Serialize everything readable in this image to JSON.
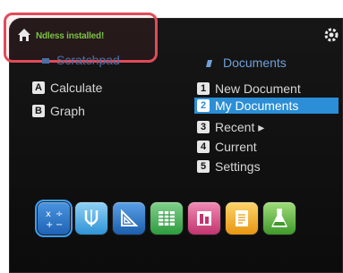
{
  "status_bar": {
    "home_icon": "home-icon",
    "text": "Ndless installed!",
    "settings_icon": "settings-icon"
  },
  "scratchpad": {
    "title": "Scratchpad",
    "items": [
      {
        "key": "A",
        "label": "Calculate"
      },
      {
        "key": "B",
        "label": "Graph"
      }
    ]
  },
  "documents": {
    "title": "Documents",
    "items": [
      {
        "key": "1",
        "label": "New Document",
        "selected": false
      },
      {
        "key": "2",
        "label": "My Documents",
        "selected": true
      },
      {
        "key": "3",
        "label": "Recent ▸",
        "selected": false
      },
      {
        "key": "4",
        "label": "Current",
        "selected": false
      },
      {
        "key": "5",
        "label": "Settings",
        "selected": false
      }
    ]
  },
  "app_bar": [
    {
      "name": "calculator-app-icon",
      "color": "#2f7fd4",
      "active": true
    },
    {
      "name": "graphs-app-icon",
      "color": "#39a7e6",
      "active": false
    },
    {
      "name": "geometry-app-icon",
      "color": "#2f7fd4",
      "active": false
    },
    {
      "name": "lists-spreadsheet-app-icon",
      "color": "#38b04a",
      "active": false
    },
    {
      "name": "data-statistics-app-icon",
      "color": "#d94a86",
      "active": false
    },
    {
      "name": "notes-app-icon",
      "color": "#f2a51c",
      "active": false
    },
    {
      "name": "vernier-dataquest-app-icon",
      "color": "#5cb33c",
      "active": false
    }
  ],
  "colors": {
    "status_text": "#7bc242",
    "highlight_outline": "#e04b5a",
    "selection": "#2b8ed6",
    "menu_text": "#d6d6d6",
    "section_title": "#6fa0d8"
  }
}
